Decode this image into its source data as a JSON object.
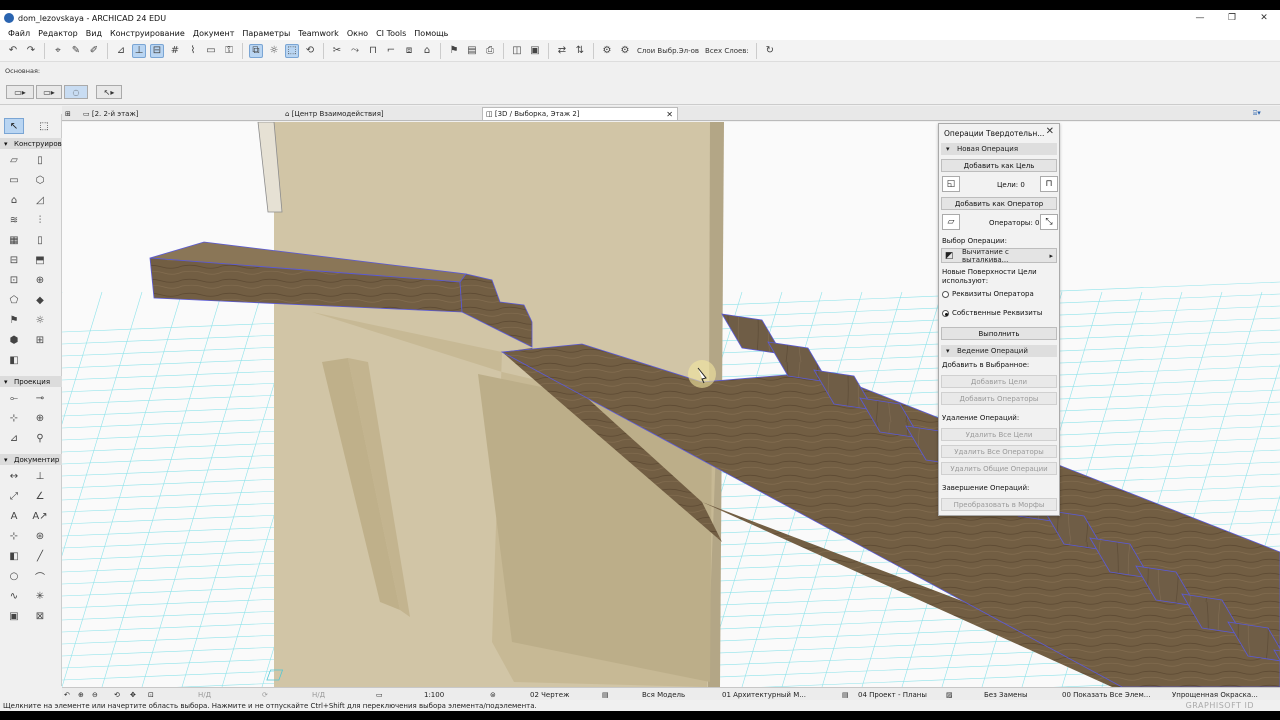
{
  "window": {
    "title": "dom_lezovskaya - ARCHICAD 24 EDU",
    "minimize": "—",
    "maximize": "❐",
    "close": "✕"
  },
  "menu": [
    "Файл",
    "Редактор",
    "Вид",
    "Конструирование",
    "Документ",
    "Параметры",
    "Teamwork",
    "Окно",
    "CI Tools",
    "Помощь"
  ],
  "toolbar": {
    "layers_label": "Слои Выбр.Эл-ов",
    "all_layers_label": "Всех Слоев:"
  },
  "infobox": {
    "label": "Основная:"
  },
  "tabs": [
    {
      "label": "[2. 2-й этаж]"
    },
    {
      "label": "[Центр Взаимодействия]"
    },
    {
      "label": "[3D / Выборка, Этаж 2]",
      "close": "✕"
    }
  ],
  "toolbox": {
    "sections": [
      "Конструиров",
      "Проекция",
      "Документир"
    ]
  },
  "palette": {
    "title": "Операции Твердотельн...",
    "close": "✕",
    "new_operation": "Новая Операция",
    "add_as_target": "Добавить как Цель",
    "targets": "Цели: 0",
    "add_as_operator": "Добавить как Оператор",
    "operators": "Операторы: 0",
    "choose_operation": "Выбор Операции:",
    "operation_value": "Вычитание с выталкива...",
    "new_surfaces": "Новые Поверхности Цели используют:",
    "radio_operator": "Реквизиты Оператора",
    "radio_own": "Собственные Реквизиты",
    "execute": "Выполнить",
    "manage_operations": "Ведение Операций",
    "add_to_selected": "Добавить в Выбранное:",
    "add_targets": "Добавить Цели",
    "add_operators": "Добавить Операторы",
    "delete_operations": "Удаление Операций:",
    "delete_all_targets": "Удалить Все Цели",
    "delete_all_operators": "Удалить Все Операторы",
    "delete_common": "Удалить Общие Операции",
    "finish_operations": "Завершение Операций:",
    "convert_morphs": "Преобразовать в Морфы"
  },
  "bottombar": {
    "na1": "Н/Д",
    "na2": "Н/Д",
    "scale": "1:100",
    "drawing": "02 Чертеж",
    "model": "Вся Модель",
    "arch": "01 Архитектурный М...",
    "project": "04 Проект - Планы",
    "no_replace": "Без Замены",
    "show_all": "00 Показать Все Элем...",
    "simplified": "Упрощенная Окраска..."
  },
  "status": {
    "message": "Щелкните на элементе или начертите область выбора. Нажмите и не отпускайте Ctrl+Shift для переключения выбора элемента/подэлемента.",
    "brand": "GRAPHISOFT ID"
  },
  "colors": {
    "grid_line": "#8fe3ea",
    "wall": "#bcb093",
    "wood": "#6e5a3f",
    "selection": "#5a5ad8"
  }
}
